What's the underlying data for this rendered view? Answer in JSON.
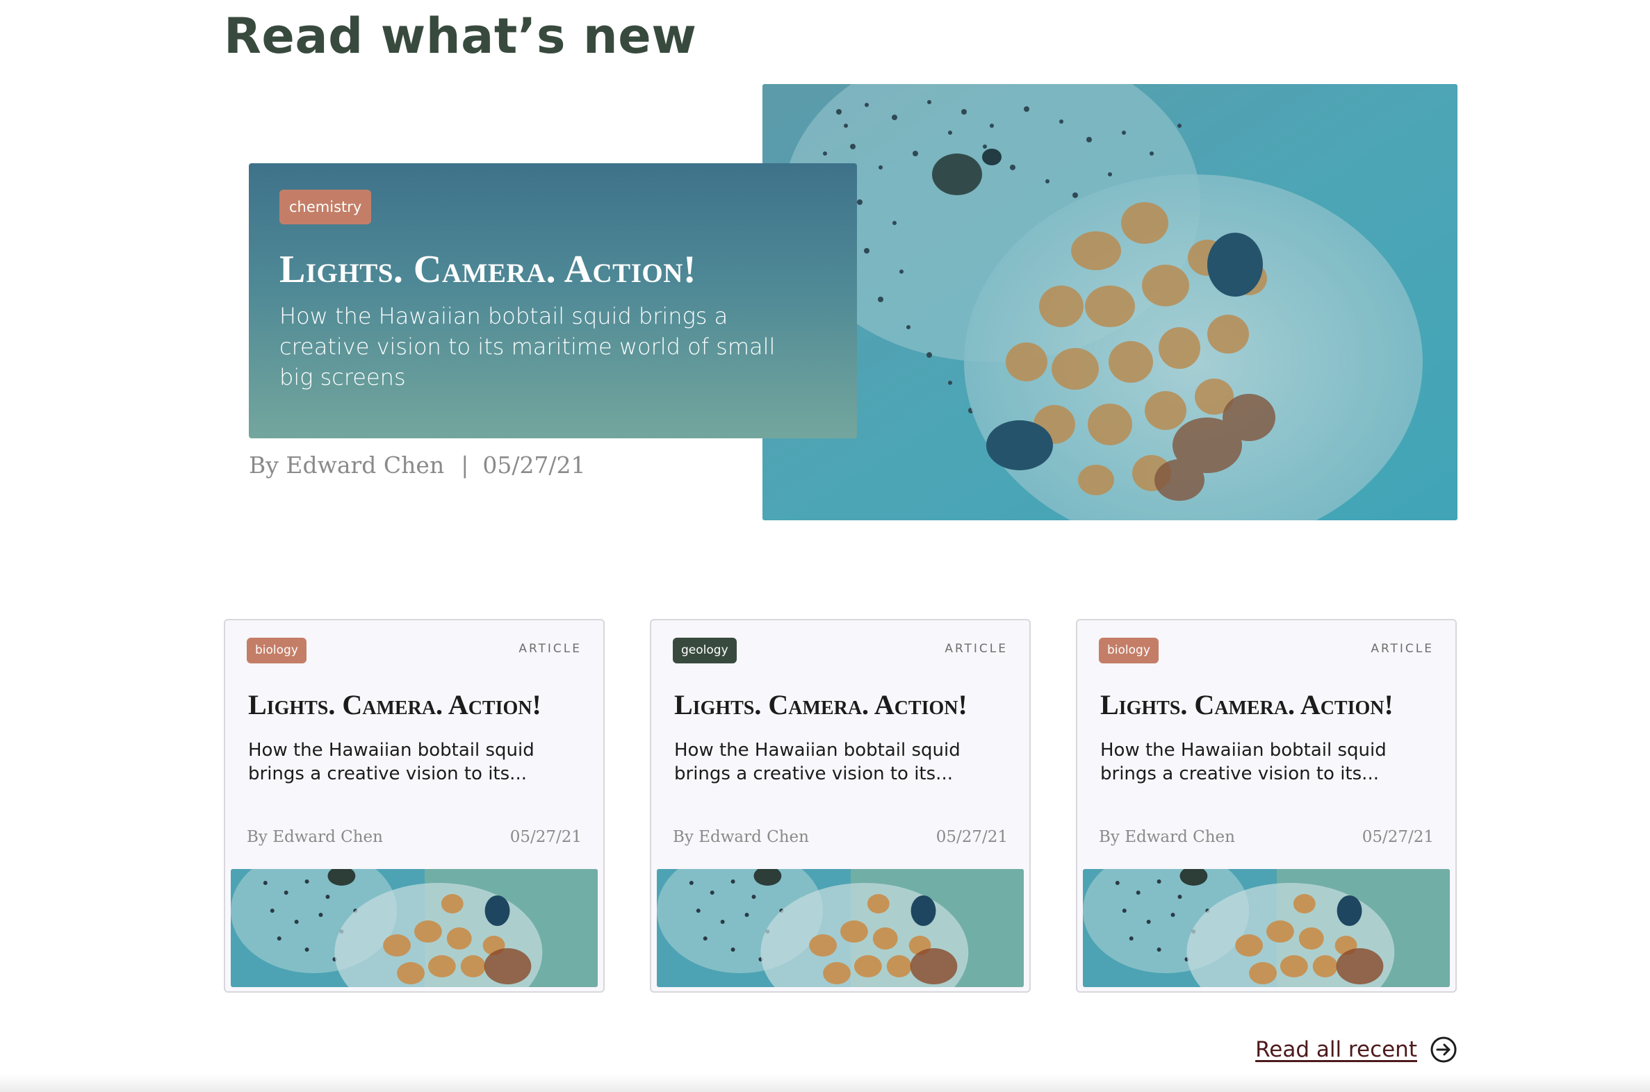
{
  "section": {
    "title": "Read what’s new"
  },
  "featured": {
    "tag": "chemistry",
    "title": "Lights. Camera. Action!",
    "description": "How the Hawaiian bobtail squid brings a creative vision to its maritime world of small big screens",
    "author": "By Edward Chen",
    "separator": "|",
    "date": "05/27/21",
    "image_icon": "squid-photo"
  },
  "cards": [
    {
      "tag": "biology",
      "type": "ARTICLE",
      "title": "Lights. Camera. Action!",
      "description": "How the Hawaiian bobtail squid brings a creative vision to its...",
      "author": "By Edward Chen",
      "date": "05/27/21"
    },
    {
      "tag": "geology",
      "type": "ARTICLE",
      "title": "Lights. Camera. Action!",
      "description": "How the Hawaiian bobtail squid brings a creative vision to its...",
      "author": "By Edward Chen",
      "date": "05/27/21"
    },
    {
      "tag": "biology",
      "type": "ARTICLE",
      "title": "Lights. Camera. Action!",
      "description": "How the Hawaiian bobtail squid brings a creative vision to its...",
      "author": "By Edward Chen",
      "date": "05/27/21"
    }
  ],
  "footer": {
    "read_all_label": "Read all recent",
    "read_all_icon": "arrow-circle-right-icon"
  },
  "colors": {
    "heading": "#384a3e",
    "tag_biology": "#c47e67",
    "tag_chemistry": "#c47e67",
    "tag_geology": "#384a3e",
    "link": "#4d1a1c",
    "featured_card_top": "#3e728a",
    "featured_card_bottom": "#73a69d"
  }
}
